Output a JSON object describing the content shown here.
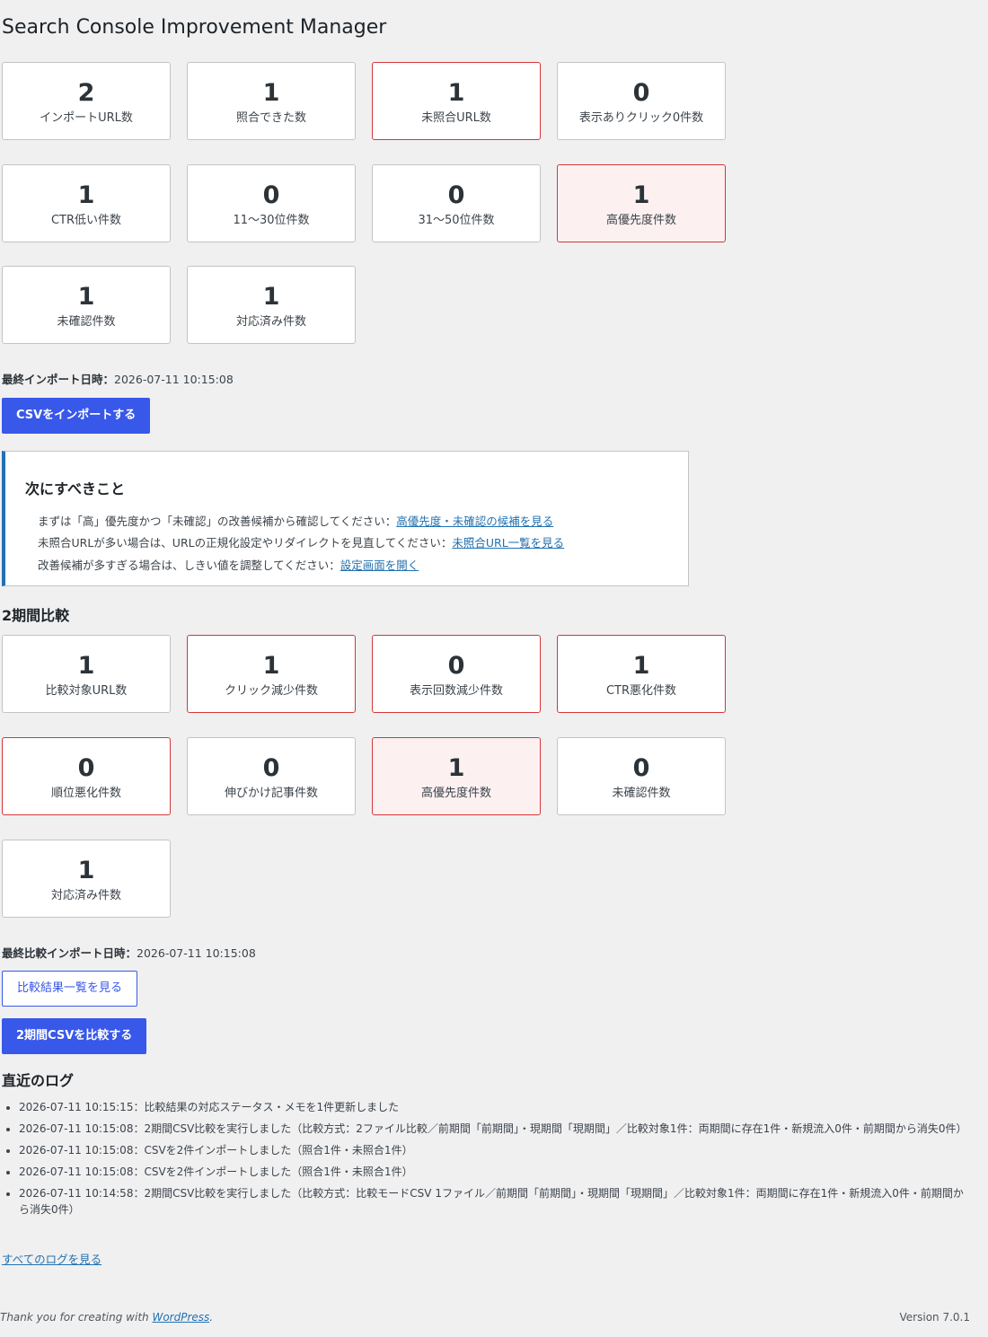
{
  "page": {
    "title": "Search Console Improvement Manager"
  },
  "summary_cards": [
    {
      "value": "2",
      "label": "インポートURL数",
      "state": "normal"
    },
    {
      "value": "1",
      "label": "照合できた数",
      "state": "normal"
    },
    {
      "value": "1",
      "label": "未照合URL数",
      "state": "alert"
    },
    {
      "value": "0",
      "label": "表示ありクリック0件数",
      "state": "normal"
    },
    {
      "value": "1",
      "label": "CTR低い件数",
      "state": "normal"
    },
    {
      "value": "0",
      "label": "11〜30位件数",
      "state": "normal"
    },
    {
      "value": "0",
      "label": "31〜50位件数",
      "state": "normal"
    },
    {
      "value": "1",
      "label": "高優先度件数",
      "state": "high"
    },
    {
      "value": "1",
      "label": "未確認件数",
      "state": "normal"
    },
    {
      "value": "1",
      "label": "対応済み件数",
      "state": "normal"
    }
  ],
  "last_import": {
    "label": "最終インポート日時：",
    "value": "2026-07-11 10:15:08"
  },
  "import_button": "CSVをインポートする",
  "next_steps": {
    "title": "次にすべきこと",
    "lines": [
      {
        "text": "まずは「高」優先度かつ「未確認」の改善候補から確認してください：",
        "link": "高優先度・未確認の候補を見る"
      },
      {
        "text": "未照合URLが多い場合は、URLの正規化設定やリダイレクトを見直してください：",
        "link": "未照合URL一覧を見る"
      },
      {
        "text": "改善候補が多すぎる場合は、しきい値を調整してください：",
        "link": "設定画面を開く"
      }
    ]
  },
  "comparison": {
    "title": "2期間比較",
    "cards": [
      {
        "value": "1",
        "label": "比較対象URL数",
        "state": "normal"
      },
      {
        "value": "1",
        "label": "クリック減少件数",
        "state": "alert"
      },
      {
        "value": "0",
        "label": "表示回数減少件数",
        "state": "alert"
      },
      {
        "value": "1",
        "label": "CTR悪化件数",
        "state": "alert"
      },
      {
        "value": "0",
        "label": "順位悪化件数",
        "state": "alert"
      },
      {
        "value": "0",
        "label": "伸びかけ記事件数",
        "state": "normal"
      },
      {
        "value": "1",
        "label": "高優先度件数",
        "state": "high"
      },
      {
        "value": "0",
        "label": "未確認件数",
        "state": "normal"
      },
      {
        "value": "1",
        "label": "対応済み件数",
        "state": "normal"
      }
    ],
    "last_import": {
      "label": "最終比較インポート日時：",
      "value": "2026-07-11 10:15:08"
    },
    "view_button": "比較結果一覧を見る",
    "compare_button": "2期間CSVを比較する"
  },
  "logs": {
    "title": "直近のログ",
    "items": [
      {
        "time": "2026-07-11 10:15:15",
        "text": "：比較結果の対応ステータス・メモを1件更新しました"
      },
      {
        "time": "2026-07-11 10:15:08",
        "text": "：2期間CSV比較を実行しました（比較方式：2ファイル比較／前期間「前期間」・現期間「現期間」／比較対象1件：両期間に存在1件・新規流入0件・前期間から消失0件）"
      },
      {
        "time": "2026-07-11 10:15:08",
        "text": "：CSVを2件インポートしました（照合1件・未照合1件）"
      },
      {
        "time": "2026-07-11 10:15:08",
        "text": "：CSVを2件インポートしました（照合1件・未照合1件）"
      },
      {
        "time": "2026-07-11 10:14:58",
        "text": "：2期間CSV比較を実行しました（比較方式：比較モードCSV 1ファイル／前期間「前期間」・現期間「現期間」／比較対象1件：両期間に存在1件・新規流入0件・前期間から消失0件）"
      }
    ],
    "all_link": "すべてのログを見る"
  },
  "footer": {
    "thanks": "Thank you for creating with ",
    "wp_link": "WordPress",
    "period": ".",
    "version": "Version 7.0.1"
  },
  "colors": {
    "accent": "#3858e9",
    "alert_border": "#d63638",
    "high_bg": "#fcf0f1",
    "notice_border": "#2271b1"
  }
}
